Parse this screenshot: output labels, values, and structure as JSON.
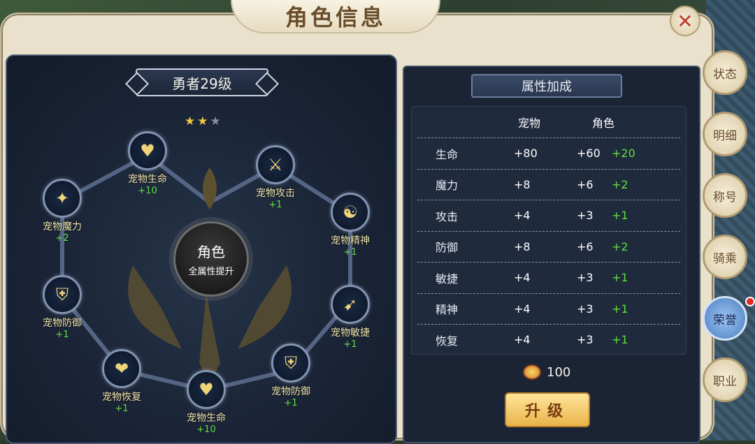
{
  "window": {
    "title": "角色信息"
  },
  "left": {
    "rank": "勇者29级",
    "stars": {
      "filled": 2,
      "total": 3,
      "on": "★",
      "off": "★"
    },
    "center": {
      "title": "角色",
      "subtitle": "全属性提升"
    },
    "nodes": [
      {
        "label": "宠物生命",
        "value": "+10",
        "icon": "heart-icon",
        "glyph": "♥"
      },
      {
        "label": "宠物攻击",
        "value": "+1",
        "icon": "sword-crest-icon",
        "glyph": "⚔"
      },
      {
        "label": "宠物魔力",
        "value": "+2",
        "icon": "magic-sparkle-icon",
        "glyph": "✦"
      },
      {
        "label": "宠物精神",
        "value": "+1",
        "icon": "spirit-icon",
        "glyph": "☯"
      },
      {
        "label": "宠物防御",
        "value": "+1",
        "icon": "shield-icon",
        "glyph": "⛨"
      },
      {
        "label": "宠物敏捷",
        "value": "+1",
        "icon": "running-icon",
        "glyph": "➹"
      },
      {
        "label": "宠物恢复",
        "value": "+1",
        "icon": "heal-heart-icon",
        "glyph": "❤"
      },
      {
        "label": "宠物防御",
        "value": "+1",
        "icon": "shield-icon",
        "glyph": "⛨"
      },
      {
        "label": "宠物生命",
        "value": "+10",
        "icon": "heart-icon",
        "glyph": "♥"
      }
    ]
  },
  "right": {
    "header": "属性加成",
    "columns": {
      "pet": "宠物",
      "role": "角色"
    },
    "rows": [
      {
        "name": "生命",
        "pet": "+80",
        "role": "+60",
        "bonus": "+20"
      },
      {
        "name": "魔力",
        "pet": "+8",
        "role": "+6",
        "bonus": "+2"
      },
      {
        "name": "攻击",
        "pet": "+4",
        "role": "+3",
        "bonus": "+1"
      },
      {
        "name": "防御",
        "pet": "+8",
        "role": "+6",
        "bonus": "+2"
      },
      {
        "name": "敏捷",
        "pet": "+4",
        "role": "+3",
        "bonus": "+1"
      },
      {
        "name": "精神",
        "pet": "+4",
        "role": "+3",
        "bonus": "+1"
      },
      {
        "name": "恢复",
        "pet": "+4",
        "role": "+3",
        "bonus": "+1"
      }
    ],
    "cost": "100",
    "upgrade": "升级"
  },
  "tabs": [
    "状态",
    "明细",
    "称号",
    "骑乘",
    "荣誉",
    "职业"
  ],
  "close": "✕",
  "colors": {
    "accent_green": "#5fdf3c",
    "gold": "#f4c842"
  }
}
